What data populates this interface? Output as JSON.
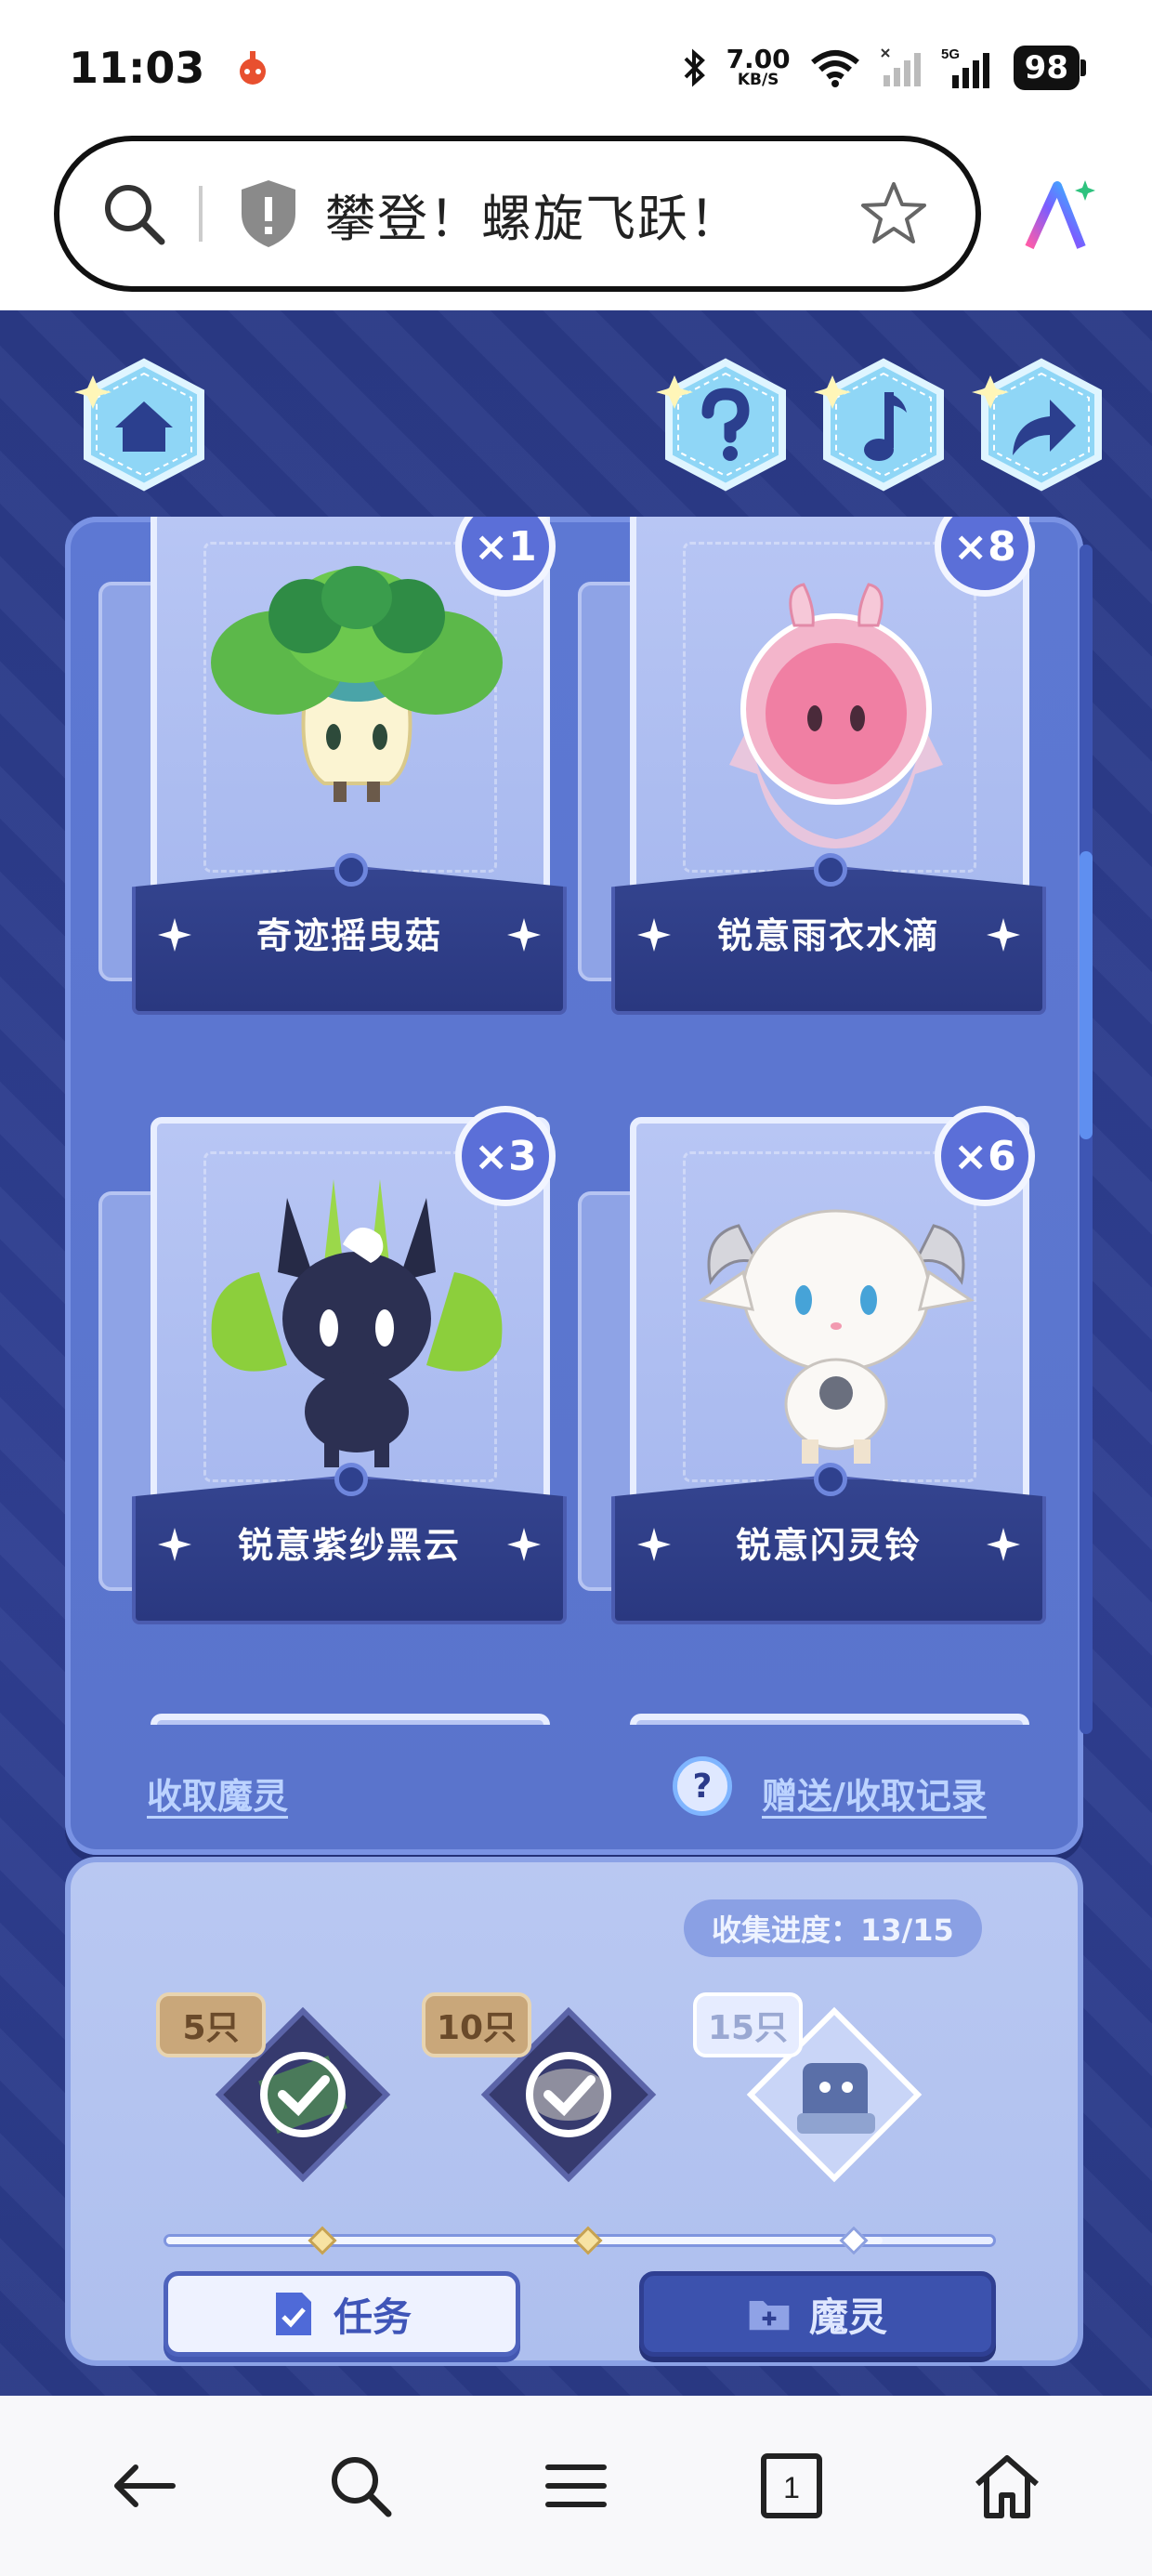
{
  "status_bar": {
    "time": "11:03",
    "net_speed_value": "7.00",
    "net_speed_unit": "KB/S",
    "network_label": "5G",
    "battery": "98"
  },
  "address_bar": {
    "title": "攀登！螺旋飞跃！"
  },
  "cards": [
    {
      "name": "奇迹摇曳菇",
      "count": "×1",
      "color": "#7cc24a"
    },
    {
      "name": "锐意雨衣水滴",
      "count": "×8",
      "color": "#f48fb1"
    },
    {
      "name": "锐意紫纱黑云",
      "count": "×3",
      "color": "#3a3e5e"
    },
    {
      "name": "锐意闪灵铃",
      "count": "×6",
      "color": "#f4f2ef"
    }
  ],
  "links": {
    "collect": "收取魔灵",
    "help": "?",
    "records": "赠送/收取记录"
  },
  "progress": {
    "label": "收集进度：13/15",
    "collected": 13,
    "total": 15,
    "milestones": [
      {
        "tag": "5只",
        "achieved": true
      },
      {
        "tag": "10只",
        "achieved": true
      },
      {
        "tag": "15只",
        "achieved": false
      }
    ]
  },
  "tabs": {
    "task": "任务",
    "spirit": "魔灵"
  },
  "colors": {
    "page_bg": "#2f3f92",
    "panel": "#5a74cc",
    "accent": "#5b6fd8"
  }
}
